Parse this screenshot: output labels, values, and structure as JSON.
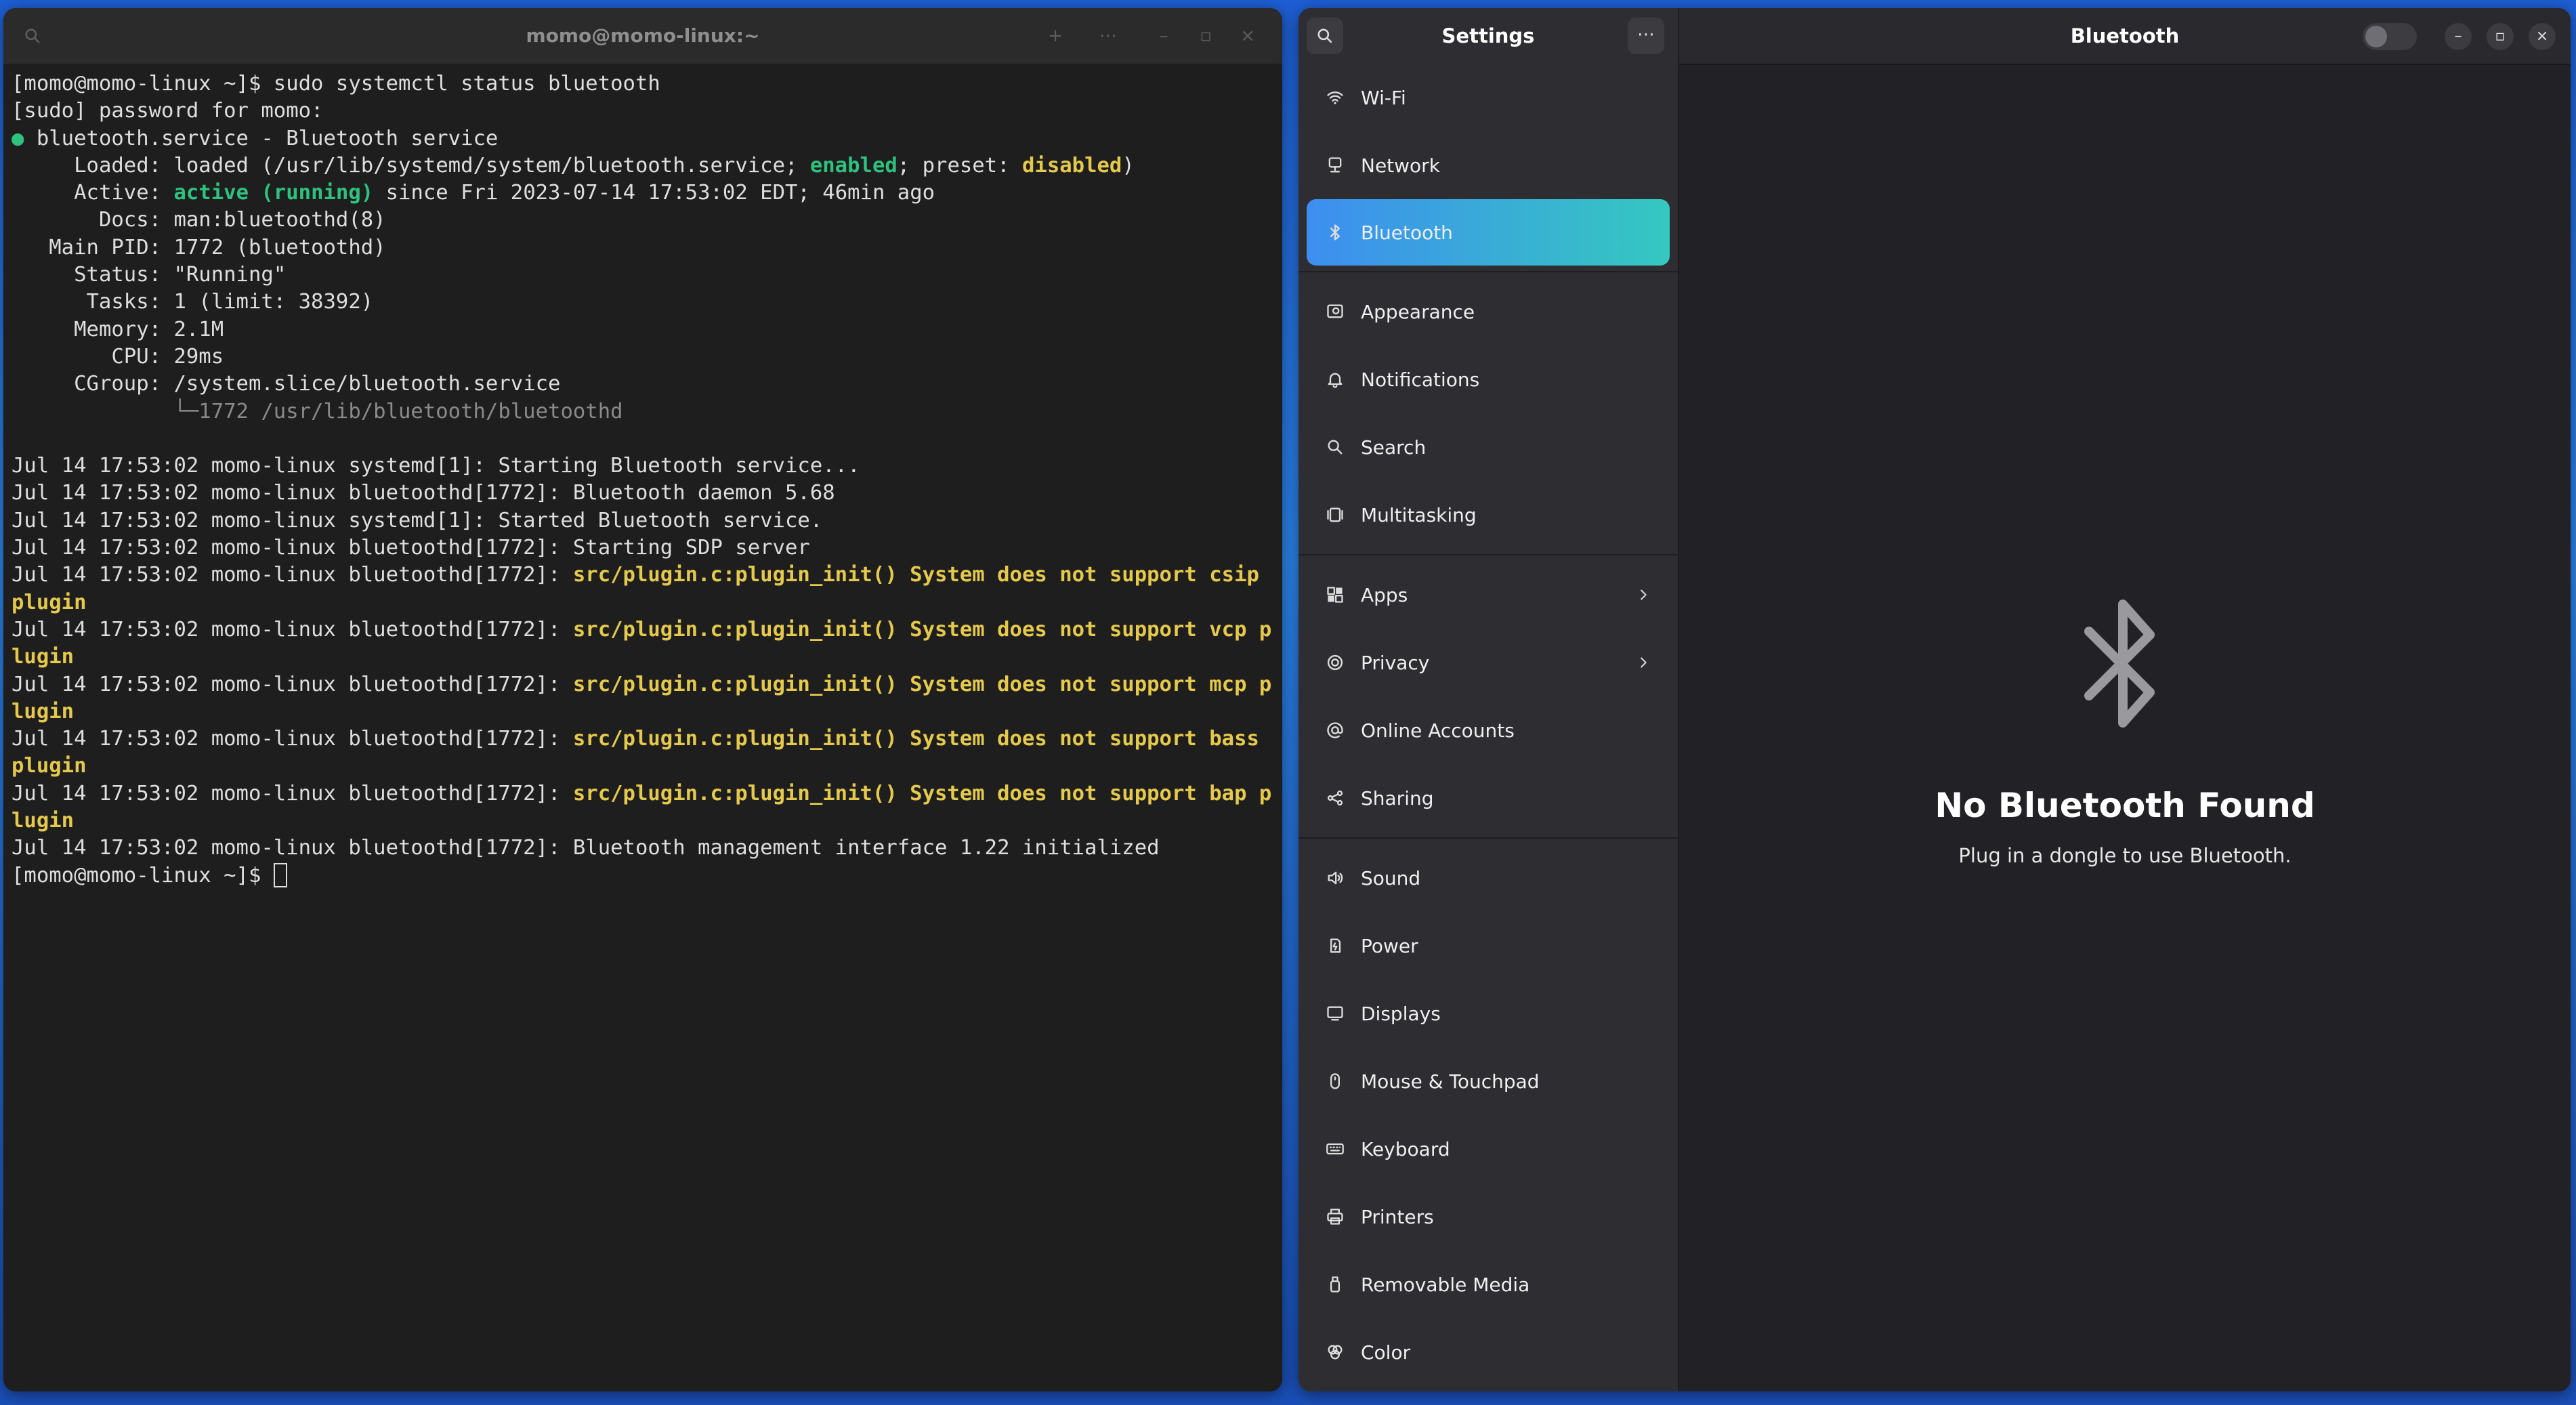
{
  "terminal": {
    "title": "momo@momo-linux:~",
    "lines": [
      [
        {
          "t": "[momo@momo-linux ~]$ sudo systemctl status bluetooth"
        }
      ],
      [
        {
          "t": "[sudo] password for momo:"
        }
      ],
      [
        {
          "t": "● ",
          "c": "g"
        },
        {
          "t": "bluetooth.service - Bluetooth service"
        }
      ],
      [
        {
          "t": "     Loaded: loaded (/usr/lib/systemd/system/bluetooth.service; "
        },
        {
          "t": "enabled",
          "c": "g"
        },
        {
          "t": "; preset: "
        },
        {
          "t": "disabled",
          "c": "y"
        },
        {
          "t": ")"
        }
      ],
      [
        {
          "t": "     Active: "
        },
        {
          "t": "active (running)",
          "c": "g"
        },
        {
          "t": " since Fri 2023-07-14 17:53:02 EDT; 46min ago"
        }
      ],
      [
        {
          "t": "       Docs: man:bluetoothd(8)"
        }
      ],
      [
        {
          "t": "   Main PID: 1772 (bluetoothd)"
        }
      ],
      [
        {
          "t": "     Status: \"Running\""
        }
      ],
      [
        {
          "t": "      Tasks: 1 (limit: 38392)"
        }
      ],
      [
        {
          "t": "     Memory: 2.1M"
        }
      ],
      [
        {
          "t": "        CPU: 29ms"
        }
      ],
      [
        {
          "t": "     CGroup: /system.slice/bluetooth.service"
        }
      ],
      [
        {
          "t": "             └─1772 /usr/lib/bluetooth/bluetoothd",
          "c": "dim"
        }
      ],
      [
        {
          "t": ""
        }
      ],
      [
        {
          "t": "Jul 14 17:53:02 momo-linux systemd[1]: Starting Bluetooth service..."
        }
      ],
      [
        {
          "t": "Jul 14 17:53:02 momo-linux bluetoothd[1772]: Bluetooth daemon 5.68"
        }
      ],
      [
        {
          "t": "Jul 14 17:53:02 momo-linux systemd[1]: Started Bluetooth service."
        }
      ],
      [
        {
          "t": "Jul 14 17:53:02 momo-linux bluetoothd[1772]: Starting SDP server"
        }
      ],
      [
        {
          "t": "Jul 14 17:53:02 momo-linux bluetoothd[1772]: "
        },
        {
          "t": "src/plugin.c:plugin_init() System does not support csip plugin",
          "c": "y"
        }
      ],
      [
        {
          "t": "Jul 14 17:53:02 momo-linux bluetoothd[1772]: "
        },
        {
          "t": "src/plugin.c:plugin_init() System does not support vcp plugin",
          "c": "y"
        }
      ],
      [
        {
          "t": "Jul 14 17:53:02 momo-linux bluetoothd[1772]: "
        },
        {
          "t": "src/plugin.c:plugin_init() System does not support mcp plugin",
          "c": "y"
        }
      ],
      [
        {
          "t": "Jul 14 17:53:02 momo-linux bluetoothd[1772]: "
        },
        {
          "t": "src/plugin.c:plugin_init() System does not support bass plugin",
          "c": "y"
        }
      ],
      [
        {
          "t": "Jul 14 17:53:02 momo-linux bluetoothd[1772]: "
        },
        {
          "t": "src/plugin.c:plugin_init() System does not support bap plugin",
          "c": "y"
        }
      ],
      [
        {
          "t": "Jul 14 17:53:02 momo-linux bluetoothd[1772]: Bluetooth management interface 1.22 initialized"
        }
      ],
      [
        {
          "t": "[momo@momo-linux ~]$ "
        },
        {
          "cursor": true
        }
      ]
    ]
  },
  "settings": {
    "sidebar_title": "Settings",
    "groups": [
      [
        {
          "label": "Wi-Fi",
          "icon": "wifi-icon"
        },
        {
          "label": "Network",
          "icon": "network-icon"
        },
        {
          "label": "Bluetooth",
          "icon": "bluetooth-icon",
          "active": true
        }
      ],
      [
        {
          "label": "Appearance",
          "icon": "appearance-icon"
        },
        {
          "label": "Notifications",
          "icon": "bell-icon"
        },
        {
          "label": "Search",
          "icon": "search-icon"
        },
        {
          "label": "Multitasking",
          "icon": "multitasking-icon"
        }
      ],
      [
        {
          "label": "Apps",
          "icon": "apps-icon",
          "chevron": true
        },
        {
          "label": "Privacy",
          "icon": "privacy-icon",
          "chevron": true
        },
        {
          "label": "Online Accounts",
          "icon": "at-icon"
        },
        {
          "label": "Sharing",
          "icon": "share-icon"
        }
      ],
      [
        {
          "label": "Sound",
          "icon": "speaker-icon"
        },
        {
          "label": "Power",
          "icon": "power-icon"
        },
        {
          "label": "Displays",
          "icon": "display-icon"
        },
        {
          "label": "Mouse & Touchpad",
          "icon": "mouse-icon"
        },
        {
          "label": "Keyboard",
          "icon": "keyboard-icon"
        },
        {
          "label": "Printers",
          "icon": "printer-icon"
        },
        {
          "label": "Removable Media",
          "icon": "usb-icon"
        },
        {
          "label": "Color",
          "icon": "color-icon"
        }
      ]
    ],
    "page_title": "Bluetooth",
    "bluetooth_enabled": false,
    "empty_title": "No Bluetooth Found",
    "empty_subtitle": "Plug in a dongle to use Bluetooth."
  }
}
